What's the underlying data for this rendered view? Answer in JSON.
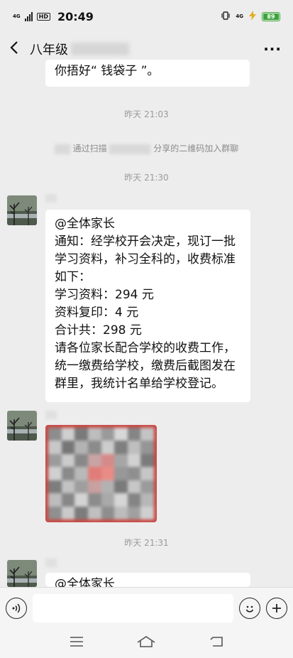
{
  "status_bar": {
    "network_1": "4G",
    "hd": "HD",
    "time": "20:49",
    "network_2": "4G",
    "battery": "89",
    "battery_color": "#3aa53a"
  },
  "header": {
    "title": "八年级",
    "back_icon": "chevron-left-icon",
    "more_icon": "more-dots-icon",
    "more_label": "···"
  },
  "messages": {
    "first_bubble_tail": "你捂好“ 钱袋子 ”。",
    "ts1": "昨天 21:03",
    "system_notice": {
      "part1": "通过扫描",
      "part2": "分享的二维码加入群聊"
    },
    "ts2": "昨天 21:30",
    "notice": {
      "lines": [
        "@全体家长",
        "通知：经学校开会决定，现订一批",
        "学习资料，补习全科的，收费标准",
        "如下：",
        "学习资料：294 元",
        "资料复印：4 元",
        "合计共：298 元",
        "请各位家长配合学校的收费工作，",
        "统一缴费给学校，缴费后截图发在",
        "群里，我统计名单给学校登记。"
      ]
    },
    "image_accent_color": "#c94a45",
    "ts3": "昨天 21:31",
    "last_bubble_partial": "@全体家长"
  },
  "input_bar": {
    "voice_icon": "voice-icon",
    "emoji_icon": "emoji-icon",
    "plus_icon": "plus-icon"
  },
  "nav_bar": {
    "menu_icon": "menu-icon",
    "home_icon": "home-icon",
    "back_icon": "back-icon"
  }
}
